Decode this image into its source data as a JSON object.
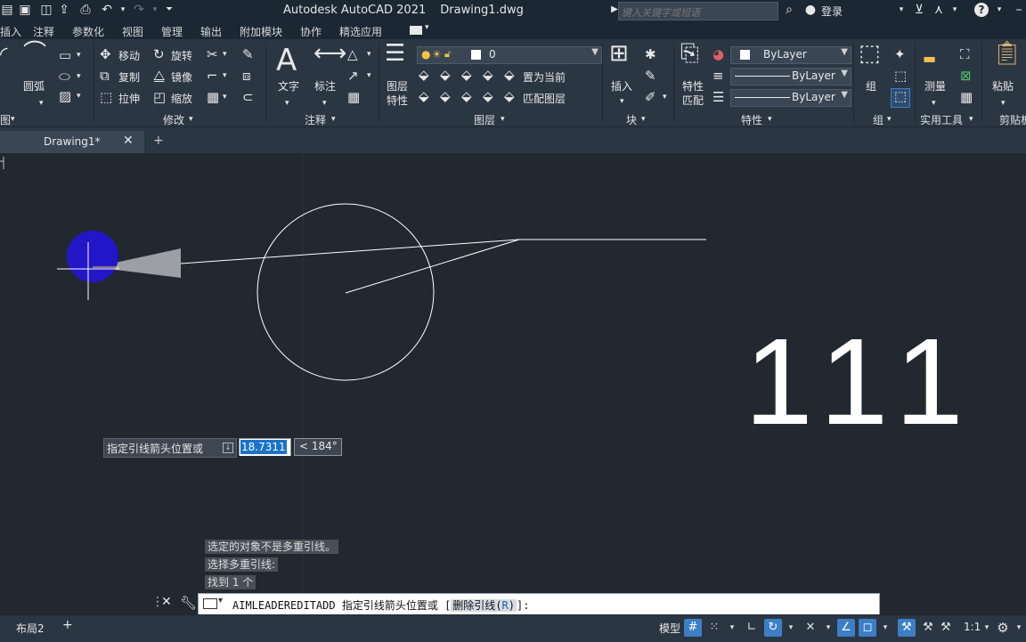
{
  "app": {
    "title": "Autodesk AutoCAD 2021",
    "drawing": "Drawing1.dwg",
    "search_placeholder": "键入关键字或短语",
    "login": "登录"
  },
  "menu_tabs": [
    "插入",
    "注释",
    "参数化",
    "视图",
    "管理",
    "输出",
    "附加模块",
    "协作",
    "精选应用"
  ],
  "ribbon": {
    "draw": {
      "arc": "圆弧",
      "title": "图"
    },
    "modify": {
      "move": "移动",
      "rotate": "旋转",
      "copy": "复制",
      "mirror": "镜像",
      "stretch": "拉伸",
      "scale": "缩放",
      "title": "修改"
    },
    "annotation": {
      "text": "文字",
      "dimension": "标注",
      "title": "注释"
    },
    "layers": {
      "layer_props_1": "图层",
      "layer_props_2": "特性",
      "layer_value": "0",
      "set_current": "置为当前",
      "match_layer": "匹配图层",
      "title": "图层"
    },
    "block": {
      "insert": "插入",
      "title": "块"
    },
    "properties": {
      "match_1": "特性",
      "match_2": "匹配",
      "color": "ByLayer",
      "linetype": "ByLayer",
      "lineweight": "ByLayer",
      "title": "特性"
    },
    "groups": {
      "group": "组",
      "title": "组"
    },
    "utilities": {
      "measure": "测量",
      "title": "实用工具"
    },
    "clipboard": {
      "paste": "粘贴",
      "title": "剪贴板"
    }
  },
  "file_tab": {
    "label": "Drawing1*"
  },
  "canvas": {
    "mtext": "111",
    "tooltip": "指定引线箭头位置或",
    "length_value": "18.7311",
    "angle_value": "< 184°"
  },
  "command_history": [
    "选定的对象不是多重引线。",
    "选择多重引线:",
    "找到 1 个"
  ],
  "command_line": {
    "command": "AIMLEADEREDITADD",
    "prompt": "指定引线箭头位置或",
    "option_text": "删除引线",
    "option_key": "R"
  },
  "status": {
    "layout_tab": "布局2",
    "model": "模型",
    "scale": "1:1"
  }
}
